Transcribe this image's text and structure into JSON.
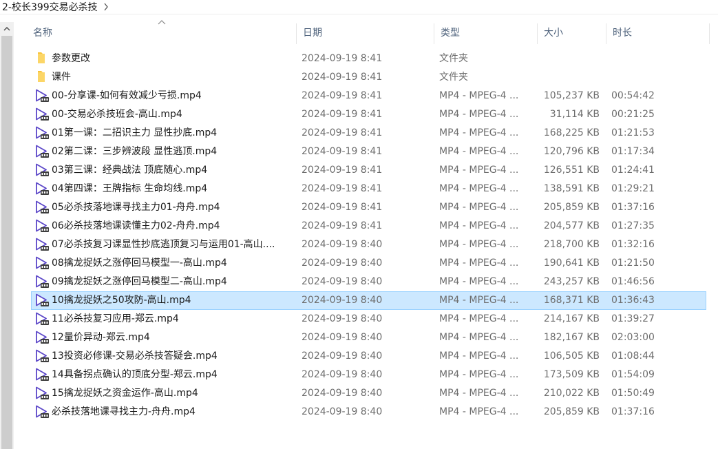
{
  "window": {
    "path": "2-校长399交易必杀技"
  },
  "columns": {
    "name": "名称",
    "date": "日期",
    "type": "类型",
    "size": "大小",
    "duration": "时长"
  },
  "colors": {
    "selected_bg": "#cce8ff",
    "selected_border": "#99d1ff",
    "folder": "#f8c33a",
    "video_icon": "#5b46c8"
  },
  "files": [
    {
      "icon": "folder-icon",
      "name": "参数更改",
      "date": "2024-09-19 8:41",
      "type": "文件夹",
      "size": "",
      "duration": ""
    },
    {
      "icon": "folder-icon",
      "name": "课件",
      "date": "2024-09-19 8:41",
      "type": "文件夹",
      "size": "",
      "duration": ""
    },
    {
      "icon": "video-file-icon",
      "name": "00-分享课-如何有效减少亏损.mp4",
      "date": "2024-09-19 8:41",
      "type": "MP4 - MPEG-4 ...",
      "size": "105,237 KB",
      "duration": "00:54:42"
    },
    {
      "icon": "video-file-icon",
      "name": "00-交易必杀技班会-高山.mp4",
      "date": "2024-09-19 8:41",
      "type": "MP4 - MPEG-4 ...",
      "size": "31,114 KB",
      "duration": "00:21:25"
    },
    {
      "icon": "video-file-icon",
      "name": "01第一课：二招识主力 显性抄底.mp4",
      "date": "2024-09-19 8:41",
      "type": "MP4 - MPEG-4 ...",
      "size": "168,225 KB",
      "duration": "01:21:53"
    },
    {
      "icon": "video-file-icon",
      "name": "02第二课：三步辨波段 显性逃顶.mp4",
      "date": "2024-09-19 8:41",
      "type": "MP4 - MPEG-4 ...",
      "size": "120,796 KB",
      "duration": "01:17:34"
    },
    {
      "icon": "video-file-icon",
      "name": "03第三课：经典战法 顶底随心.mp4",
      "date": "2024-09-19 8:41",
      "type": "MP4 - MPEG-4 ...",
      "size": "126,551 KB",
      "duration": "01:24:41"
    },
    {
      "icon": "video-file-icon",
      "name": "04第四课：王牌指标 生命均线.mp4",
      "date": "2024-09-19 8:41",
      "type": "MP4 - MPEG-4 ...",
      "size": "138,591 KB",
      "duration": "01:29:21"
    },
    {
      "icon": "video-file-icon",
      "name": "05必杀技落地课寻找主力01-舟舟.mp4",
      "date": "2024-09-19 8:41",
      "type": "MP4 - MPEG-4 ...",
      "size": "205,859 KB",
      "duration": "01:37:16"
    },
    {
      "icon": "video-file-icon",
      "name": "06必杀技落地课读懂主力02-舟舟.mp4",
      "date": "2024-09-19 8:41",
      "type": "MP4 - MPEG-4 ...",
      "size": "204,577 KB",
      "duration": "01:27:35"
    },
    {
      "icon": "video-file-icon",
      "name": "07必杀技复习课显性抄底逃顶复习与运用01-高山....",
      "date": "2024-09-19 8:40",
      "type": "MP4 - MPEG-4 ...",
      "size": "218,700 KB",
      "duration": "01:32:16"
    },
    {
      "icon": "video-file-icon",
      "name": "08擒龙捉妖之涨停回马模型一-高山.mp4",
      "date": "2024-09-19 8:40",
      "type": "MP4 - MPEG-4 ...",
      "size": "190,641 KB",
      "duration": "01:21:50"
    },
    {
      "icon": "video-file-icon",
      "name": "09擒龙捉妖之涨停回马模型二-高山.mp4",
      "date": "2024-09-19 8:40",
      "type": "MP4 - MPEG-4 ...",
      "size": "243,257 KB",
      "duration": "01:46:56"
    },
    {
      "icon": "video-file-icon",
      "name": "10擒龙捉妖之50攻防-高山.mp4",
      "date": "2024-09-19 8:40",
      "type": "MP4 - MPEG-4 ...",
      "size": "168,371 KB",
      "duration": "01:36:43",
      "selected": true
    },
    {
      "icon": "video-file-icon",
      "name": "11必杀技复习应用-郑云.mp4",
      "date": "2024-09-19 8:40",
      "type": "MP4 - MPEG-4 ...",
      "size": "214,167 KB",
      "duration": "01:39:27"
    },
    {
      "icon": "video-file-icon",
      "name": "12量价异动-郑云.mp4",
      "date": "2024-09-19 8:40",
      "type": "MP4 - MPEG-4 ...",
      "size": "182,167 KB",
      "duration": "02:03:00"
    },
    {
      "icon": "video-file-icon",
      "name": "13投资必修课-交易必杀技答疑会.mp4",
      "date": "2024-09-19 8:40",
      "type": "MP4 - MPEG-4 ...",
      "size": "106,505 KB",
      "duration": "01:08:44"
    },
    {
      "icon": "video-file-icon",
      "name": "14具备拐点确认的顶底分型-郑云.mp4",
      "date": "2024-09-19 8:40",
      "type": "MP4 - MPEG-4 ...",
      "size": "173,509 KB",
      "duration": "01:54:09"
    },
    {
      "icon": "video-file-icon",
      "name": "15擒龙捉妖之资金运作-高山.mp4",
      "date": "2024-09-19 8:40",
      "type": "MP4 - MPEG-4 ...",
      "size": "210,022 KB",
      "duration": "01:50:49"
    },
    {
      "icon": "video-file-icon",
      "name": "必杀技落地课寻找主力-舟舟.mp4",
      "date": "2024-09-19 8:40",
      "type": "MP4 - MPEG-4 ...",
      "size": "205,859 KB",
      "duration": "01:37:16"
    }
  ]
}
